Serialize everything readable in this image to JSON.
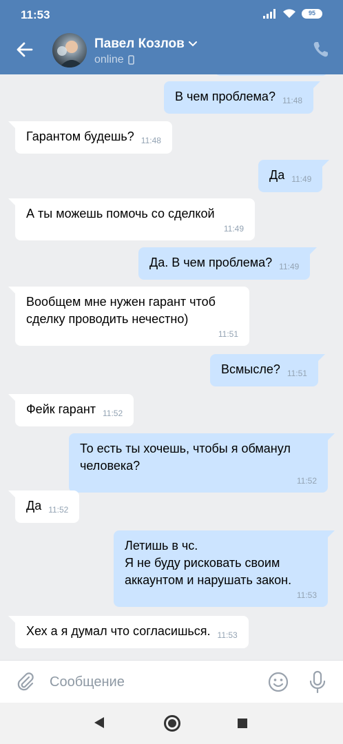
{
  "status_bar": {
    "time": "11:53",
    "battery": "95"
  },
  "header": {
    "name": "Павел Козлов",
    "status": "online"
  },
  "messages": [
    {
      "dir": "out",
      "text": "В чем проблема?",
      "time": "11:48"
    },
    {
      "dir": "in",
      "text": "Гарантом будешь?",
      "time": "11:48"
    },
    {
      "dir": "out",
      "text": "Да",
      "time": "11:49"
    },
    {
      "dir": "in",
      "text": "А ты можешь помочь со сделкой",
      "time": "11:49"
    },
    {
      "dir": "out",
      "text": "Да. В чем проблема?",
      "time": "11:49"
    },
    {
      "dir": "in",
      "text": "Вообщем мне нужен гарант чтоб\nсделку проводить нечестно)",
      "time": "11:51"
    },
    {
      "dir": "out",
      "text": "Всмысле?",
      "time": "11:51"
    },
    {
      "dir": "in",
      "text": "Фейк гарант",
      "time": "11:52"
    },
    {
      "dir": "out",
      "text": "То есть ты хочешь, чтобы я обманул\nчеловека?",
      "time": "11:52"
    },
    {
      "dir": "in",
      "text": "Да",
      "time": "11:52"
    },
    {
      "dir": "out",
      "text": "Летишь в чс.\nЯ не буду рисковать своим\nаккаунтом и нарушать закон.",
      "time": "11:53"
    },
    {
      "dir": "in",
      "text": "Хех а я думал что согласишься.",
      "time": "11:53"
    }
  ],
  "composer": {
    "placeholder": "Сообщение"
  },
  "colors": {
    "header": "#5181b8",
    "background": "#edeef0",
    "incoming": "#ffffff",
    "outgoing": "#cce4ff"
  }
}
